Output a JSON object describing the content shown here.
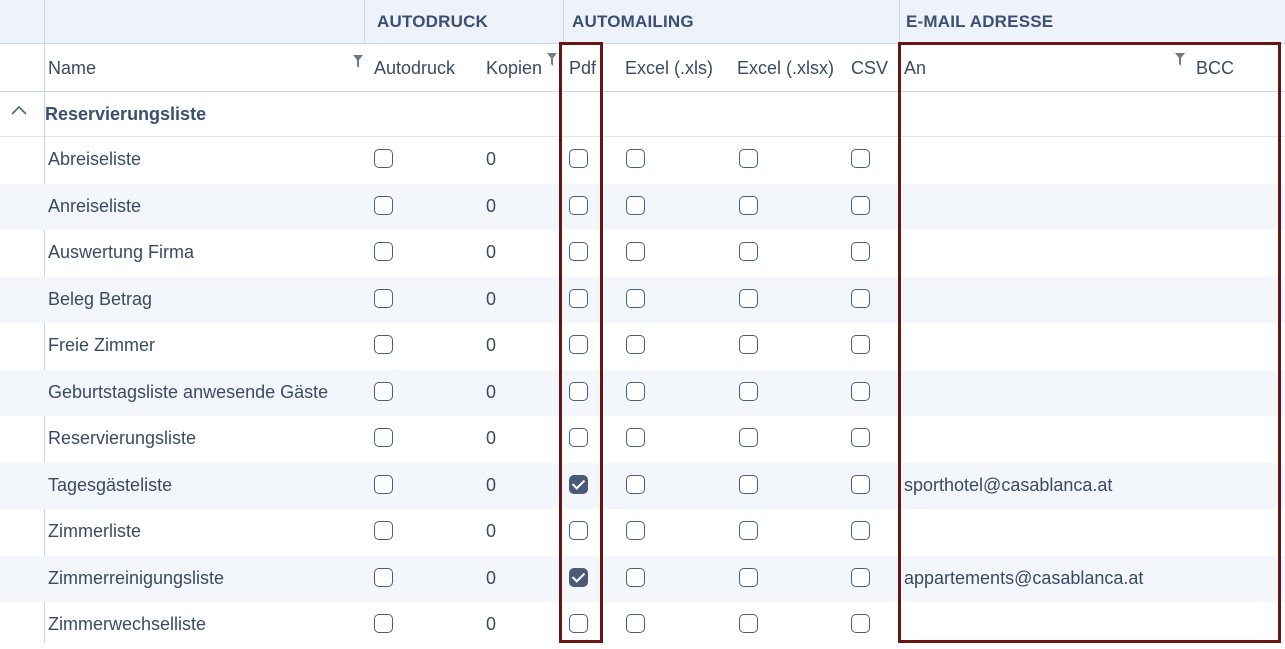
{
  "groups": {
    "autodruck": "AUTODRUCK",
    "automailing": "AUTOMAILING",
    "email": "E-MAIL ADRESSE"
  },
  "columns": {
    "name": "Name",
    "autodruck": "Autodruck",
    "kopien": "Kopien",
    "pdf": "Pdf",
    "xls": "Excel (.xls)",
    "xlsx": "Excel (.xlsx)",
    "csv": "CSV",
    "an": "An",
    "bcc": "BCC"
  },
  "group_row": {
    "label": "Reservierungsliste"
  },
  "rows": [
    {
      "name": "Abreiseliste",
      "autodruck": false,
      "kopien": "0",
      "pdf": false,
      "xls": false,
      "xlsx": false,
      "csv": false,
      "an": "",
      "bcc": ""
    },
    {
      "name": "Anreiseliste",
      "autodruck": false,
      "kopien": "0",
      "pdf": false,
      "xls": false,
      "xlsx": false,
      "csv": false,
      "an": "",
      "bcc": ""
    },
    {
      "name": "Auswertung Firma",
      "autodruck": false,
      "kopien": "0",
      "pdf": false,
      "xls": false,
      "xlsx": false,
      "csv": false,
      "an": "",
      "bcc": ""
    },
    {
      "name": "Beleg Betrag",
      "autodruck": false,
      "kopien": "0",
      "pdf": false,
      "xls": false,
      "xlsx": false,
      "csv": false,
      "an": "",
      "bcc": ""
    },
    {
      "name": "Freie Zimmer",
      "autodruck": false,
      "kopien": "0",
      "pdf": false,
      "xls": false,
      "xlsx": false,
      "csv": false,
      "an": "",
      "bcc": ""
    },
    {
      "name": "Geburtstagsliste anwesende Gäste",
      "autodruck": false,
      "kopien": "0",
      "pdf": false,
      "xls": false,
      "xlsx": false,
      "csv": false,
      "an": "",
      "bcc": ""
    },
    {
      "name": "Reservierungsliste",
      "autodruck": false,
      "kopien": "0",
      "pdf": false,
      "xls": false,
      "xlsx": false,
      "csv": false,
      "an": "",
      "bcc": ""
    },
    {
      "name": "Tagesgästeliste",
      "autodruck": false,
      "kopien": "0",
      "pdf": true,
      "xls": false,
      "xlsx": false,
      "csv": false,
      "an": "sporthotel@casablanca.at",
      "bcc": ""
    },
    {
      "name": "Zimmerliste",
      "autodruck": false,
      "kopien": "0",
      "pdf": false,
      "xls": false,
      "xlsx": false,
      "csv": false,
      "an": "",
      "bcc": ""
    },
    {
      "name": "Zimmerreinigungsliste",
      "autodruck": false,
      "kopien": "0",
      "pdf": true,
      "xls": false,
      "xlsx": false,
      "csv": false,
      "an": "appartements@casablanca.at",
      "bcc": ""
    },
    {
      "name": "Zimmerwechselliste",
      "autodruck": false,
      "kopien": "0",
      "pdf": false,
      "xls": false,
      "xlsx": false,
      "csv": false,
      "an": "",
      "bcc": ""
    }
  ],
  "colors": {
    "highlight": "#6b1414",
    "header_bg": "#eef2fa",
    "checkbox_checked": "#4a5a78"
  },
  "icons": {
    "filter": "filter-icon",
    "expand": "chevron-up-icon"
  }
}
